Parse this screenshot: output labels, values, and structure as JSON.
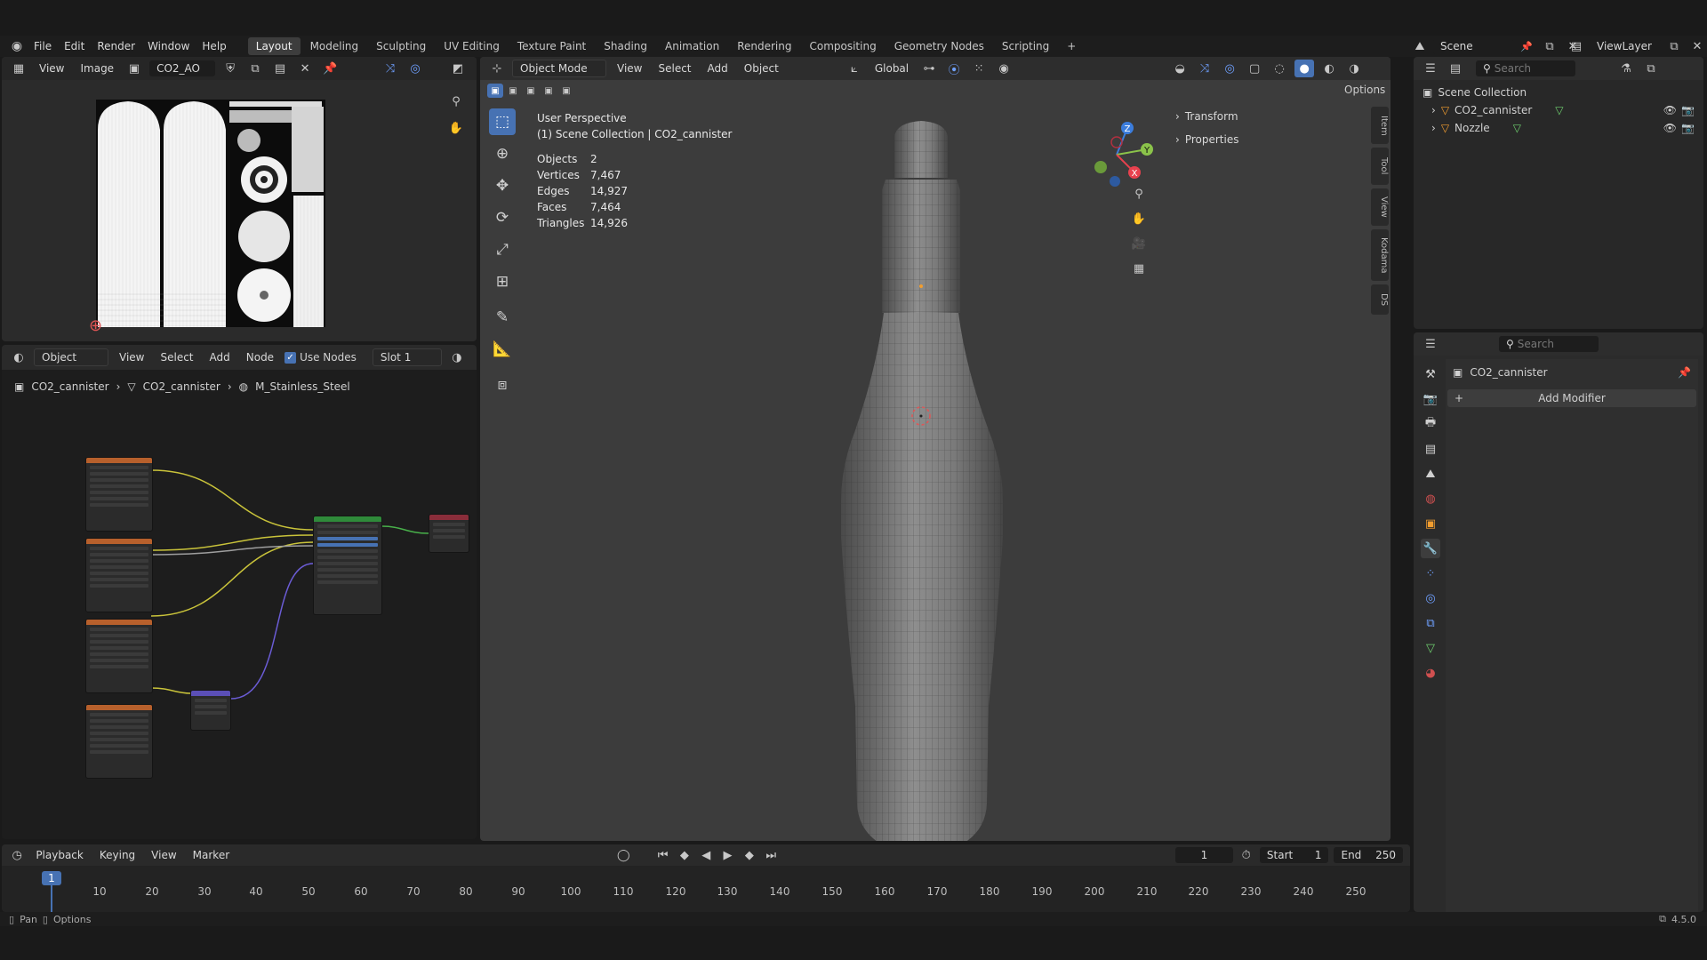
{
  "topbar": {
    "menus": [
      "File",
      "Edit",
      "Render",
      "Window",
      "Help"
    ],
    "workspaces": [
      "Layout",
      "Modeling",
      "Sculpting",
      "UV Editing",
      "Texture Paint",
      "Shading",
      "Animation",
      "Rendering",
      "Compositing",
      "Geometry Nodes",
      "Scripting"
    ],
    "active_workspace": "Layout",
    "add_tab": "+",
    "scene_label": "Scene",
    "viewlayer_label": "ViewLayer"
  },
  "image_editor": {
    "menus": [
      "View",
      "Image"
    ],
    "image_name": "CO2_AO"
  },
  "shader_editor": {
    "object_dropdown": "Object",
    "menus": [
      "View",
      "Select",
      "Add",
      "Node"
    ],
    "use_nodes_label": "Use Nodes",
    "slot_label": "Slot 1",
    "breadcrumb": [
      "CO2_cannister",
      "CO2_cannister",
      "M_Stainless_Steel"
    ]
  },
  "viewport": {
    "mode": "Object Mode",
    "menus": [
      "View",
      "Select",
      "Add",
      "Object"
    ],
    "orientation": "Global",
    "options_label": "Options",
    "perspective": "User Perspective",
    "collection_path": "(1) Scene Collection | CO2_cannister",
    "stats": [
      {
        "label": "Objects",
        "value": "2"
      },
      {
        "label": "Vertices",
        "value": "7,467"
      },
      {
        "label": "Edges",
        "value": "14,927"
      },
      {
        "label": "Faces",
        "value": "7,464"
      },
      {
        "label": "Triangles",
        "value": "14,926"
      }
    ],
    "npanel_sections": [
      "Transform",
      "Properties"
    ],
    "npanel_tabs": [
      "Item",
      "Tool",
      "View",
      "Kodama",
      "DS"
    ],
    "gizmo_axes": [
      "Z",
      "Y",
      "X"
    ]
  },
  "outliner": {
    "search_placeholder": "Search",
    "root": "Scene Collection",
    "items": [
      "CO2_cannister",
      "Nozzle"
    ]
  },
  "properties": {
    "search_placeholder": "Search",
    "object_name": "CO2_cannister",
    "add_modifier_label": "Add Modifier"
  },
  "timeline": {
    "menus": [
      "Playback",
      "Keying",
      "View",
      "Marker"
    ],
    "current_frame": "1",
    "start_label": "Start",
    "start_value": "1",
    "end_label": "End",
    "end_value": "250",
    "ticks": [
      "1",
      "10",
      "20",
      "30",
      "40",
      "50",
      "60",
      "70",
      "80",
      "90",
      "100",
      "110",
      "120",
      "130",
      "140",
      "150",
      "160",
      "170",
      "180",
      "190",
      "200",
      "210",
      "220",
      "230",
      "240",
      "250"
    ]
  },
  "statusbar": {
    "pan_label": "Pan",
    "options_label": "Options",
    "version": "4.5.0"
  },
  "colors": {
    "accent": "#4772b3",
    "header": "#262626",
    "panel": "#303030",
    "viewport_bg": "#3c3c3c",
    "axis_x": "#e8414e",
    "axis_y": "#8bc34a",
    "axis_z": "#3b7ddd"
  }
}
